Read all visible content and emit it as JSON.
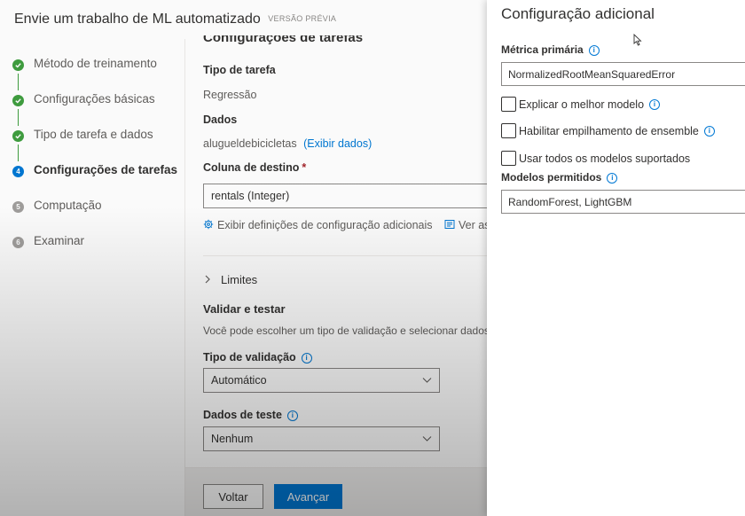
{
  "app": {
    "title": "Envie um trabalho de ML automatizado",
    "badge": "VERSÃO PRÉVIA"
  },
  "steps": [
    {
      "label": "Método de treinamento",
      "state": "done",
      "number": ""
    },
    {
      "label": "Configurações básicas",
      "state": "done",
      "number": ""
    },
    {
      "label": "Tipo de tarefa e dados",
      "state": "done",
      "number": ""
    },
    {
      "label": "Configurações de tarefas",
      "state": "active",
      "number": "4"
    },
    {
      "label": "Computação",
      "state": "todo",
      "number": "5"
    },
    {
      "label": "Examinar",
      "state": "todo",
      "number": "6"
    }
  ],
  "main": {
    "section_title": "Configurações de tarefas",
    "task_type_label": "Tipo de tarefa",
    "task_type_value": "Regressão",
    "data_label": "Dados",
    "data_value": "alugueldebicicletas",
    "data_link": "(Exibir dados)",
    "target_label": "Coluna de destino",
    "target_required": "*",
    "target_value": "rentals (Integer)",
    "extra_config_link": "Exibir definições de configuração adicionais",
    "featurization_link": "Ver as co",
    "limits_label": "Limites",
    "validate_title": "Validar e testar",
    "validate_desc": "Você pode escolher um tipo de validação e selecionar dados d",
    "validation_type_label": "Tipo de validação",
    "validation_type_value": "Automático",
    "test_data_label": "Dados de teste",
    "test_data_value": "Nenhum"
  },
  "footer": {
    "back_label": "Voltar",
    "next_label": "Avançar"
  },
  "panel": {
    "title": "Configuração adicional",
    "primary_metric_label": "Métrica primária",
    "primary_metric_value": "NormalizedRootMeanSquaredError",
    "explain_best_model": "Explicar o melhor modelo",
    "enable_stack_ensemble": "Habilitar empilhamento de ensemble",
    "use_all_models": "Usar todos os modelos suportados",
    "allowed_models_label": "Modelos permitidos",
    "allowed_models_value": "RandomForest, LightGBM"
  },
  "colors": {
    "accent": "#0078d4",
    "success": "#3f9e3f",
    "required": "#a4262c"
  }
}
